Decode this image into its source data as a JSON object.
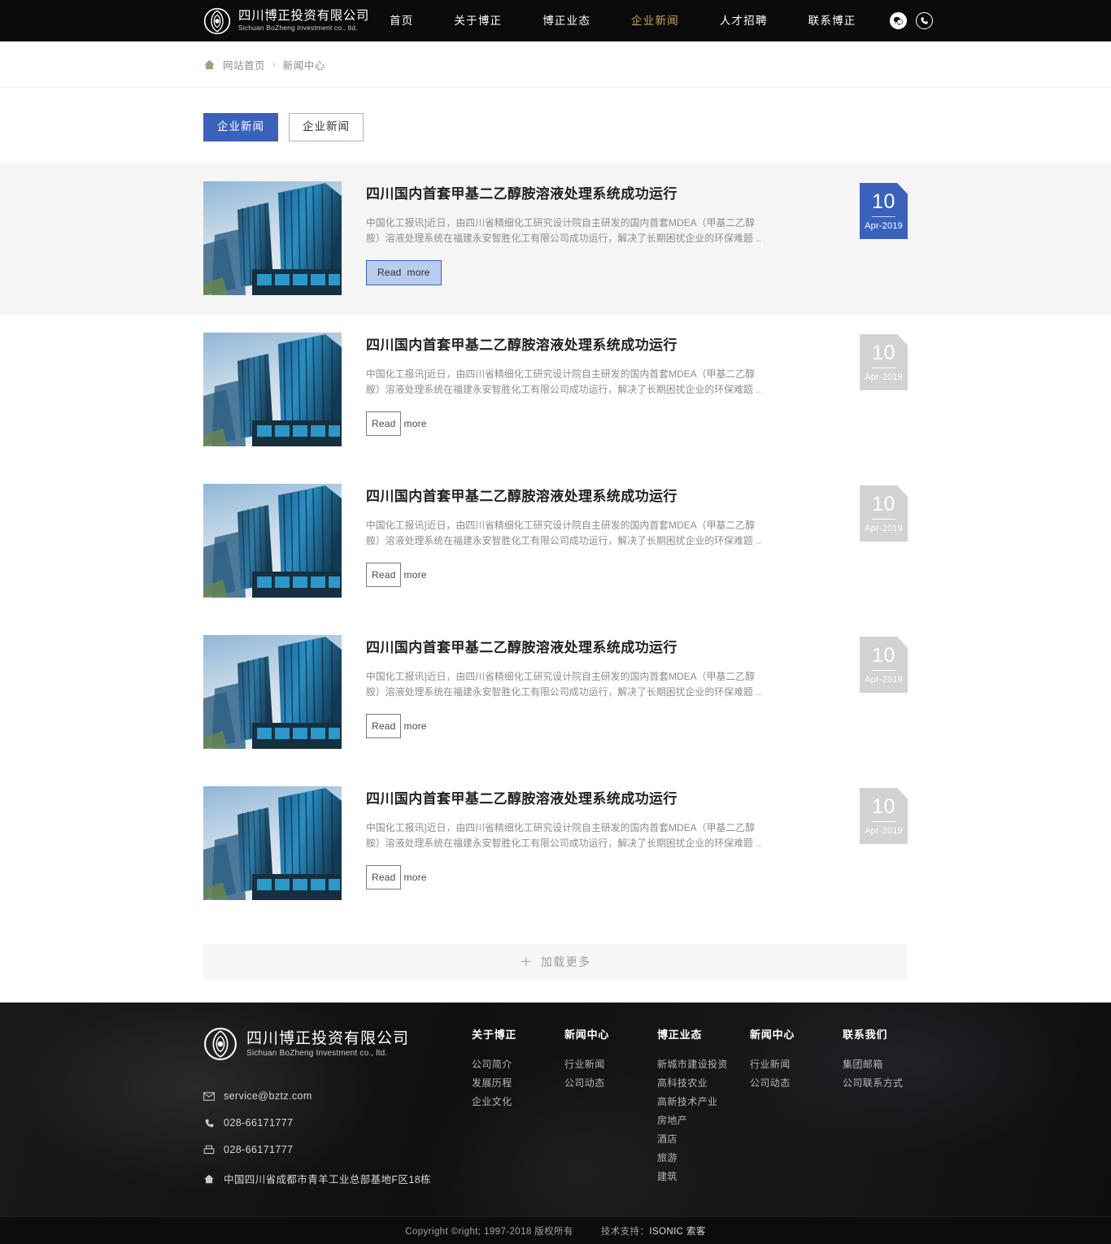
{
  "header": {
    "brand": {
      "name_cn": "四川博正投资有限公司",
      "name_en": "Sichuan BoZheng Investment co., ltd.",
      "logo_icon": "bozheng-logo-icon"
    },
    "nav": [
      {
        "label": "首页",
        "active": false
      },
      {
        "label": "关于博正",
        "active": false
      },
      {
        "label": "博正业态",
        "active": false
      },
      {
        "label": "企业新闻",
        "active": true
      },
      {
        "label": "人才招聘",
        "active": false
      },
      {
        "label": "联系博正",
        "active": false
      }
    ],
    "icons": [
      {
        "name": "wechat-icon"
      },
      {
        "name": "phone-icon"
      }
    ],
    "accent_color": "#c9a45d",
    "background_color": "#0b0b0b"
  },
  "breadcrumb": {
    "home_icon": "home-icon",
    "home_label": "网站首页",
    "separator": "›",
    "current": "新闻中心"
  },
  "tabs": [
    {
      "label": "企业新闻",
      "active": true
    },
    {
      "label": "企业新闻",
      "active": false
    }
  ],
  "news": {
    "items": [
      {
        "title": "四川国内首套甲基二乙醇胺溶液处理系统成功运行",
        "excerpt": "中国化工报讯]近日，由四川省精细化工研究设计院自主研发的国内首套MDEA（甲基二乙醇胺）溶液处理系统在福建永安智胜化工有限公司成功运行，解决了长期困扰企业的环保难题 ..",
        "read_more_primary": "Read",
        "read_more_secondary": "more",
        "day": "10",
        "month_year": "Apr-2019",
        "highlighted": true,
        "thumb_icon": "news-thumbnail-skyscrapers"
      },
      {
        "title": "四川国内首套甲基二乙醇胺溶液处理系统成功运行",
        "excerpt": "中国化工报讯]近日，由四川省精细化工研究设计院自主研发的国内首套MDEA（甲基二乙醇胺）溶液处理系统在福建永安智胜化工有限公司成功运行，解决了长期困扰企业的环保难题 ..",
        "read_more_primary": "Read",
        "read_more_secondary": "more",
        "day": "10",
        "month_year": "Apr-2019",
        "highlighted": false,
        "thumb_icon": "news-thumbnail-skyscrapers"
      },
      {
        "title": "四川国内首套甲基二乙醇胺溶液处理系统成功运行",
        "excerpt": "中国化工报讯]近日，由四川省精细化工研究设计院自主研发的国内首套MDEA（甲基二乙醇胺）溶液处理系统在福建永安智胜化工有限公司成功运行，解决了长期困扰企业的环保难题 ..",
        "read_more_primary": "Read",
        "read_more_secondary": "more",
        "day": "10",
        "month_year": "Apr-2019",
        "highlighted": false,
        "thumb_icon": "news-thumbnail-skyscrapers"
      },
      {
        "title": "四川国内首套甲基二乙醇胺溶液处理系统成功运行",
        "excerpt": "中国化工报讯]近日，由四川省精细化工研究设计院自主研发的国内首套MDEA（甲基二乙醇胺）溶液处理系统在福建永安智胜化工有限公司成功运行，解决了长期困扰企业的环保难题 ..",
        "read_more_primary": "Read",
        "read_more_secondary": "more",
        "day": "10",
        "month_year": "Apr-2019",
        "highlighted": false,
        "thumb_icon": "news-thumbnail-skyscrapers"
      },
      {
        "title": "四川国内首套甲基二乙醇胺溶液处理系统成功运行",
        "excerpt": "中国化工报讯]近日，由四川省精细化工研究设计院自主研发的国内首套MDEA（甲基二乙醇胺）溶液处理系统在福建永安智胜化工有限公司成功运行，解决了长期困扰企业的环保难题 ..",
        "read_more_primary": "Read",
        "read_more_secondary": "more",
        "day": "10",
        "month_year": "Apr-2019",
        "highlighted": false,
        "thumb_icon": "news-thumbnail-skyscrapers"
      }
    ],
    "load_more": {
      "icon": "plus-icon",
      "label": "加载更多"
    },
    "active_badge_color": "#3a62bd",
    "inactive_badge_color": "#d2d2d2"
  },
  "footer": {
    "brand": {
      "name_cn": "四川博正投资有限公司",
      "name_en": "Sichuan BoZheng Investment co., ltd.",
      "logo_icon": "bozheng-logo-icon"
    },
    "contacts": [
      {
        "icon": "email-icon",
        "value": "service@bztz.com"
      },
      {
        "icon": "phone-icon",
        "value": "028-66171777"
      },
      {
        "icon": "fax-icon",
        "value": "028-66171777"
      },
      {
        "icon": "address-icon",
        "value": "中国四川省成都市青羊工业总部基地F区18栋"
      }
    ],
    "columns": [
      {
        "title": "关于博正",
        "links": [
          "公司简介",
          "发展历程",
          "企业文化"
        ]
      },
      {
        "title": "新闻中心",
        "links": [
          "行业新闻",
          "公司动态"
        ]
      },
      {
        "title": "博正业态",
        "links": [
          "新城市建设投资",
          "高科技农业",
          "高新技术产业",
          "房地产",
          "酒店",
          "旅游",
          "建筑"
        ]
      },
      {
        "title": "新闻中心",
        "links": [
          "行业新闻",
          "公司动态"
        ]
      },
      {
        "title": "联系我们",
        "links": [
          "集团邮箱",
          "公司联系方式"
        ]
      }
    ],
    "copyright": "Copyright ©right; 1997-2018 版权所有",
    "support_label": "技术支持：",
    "support_name": "ISONIC 索客"
  }
}
